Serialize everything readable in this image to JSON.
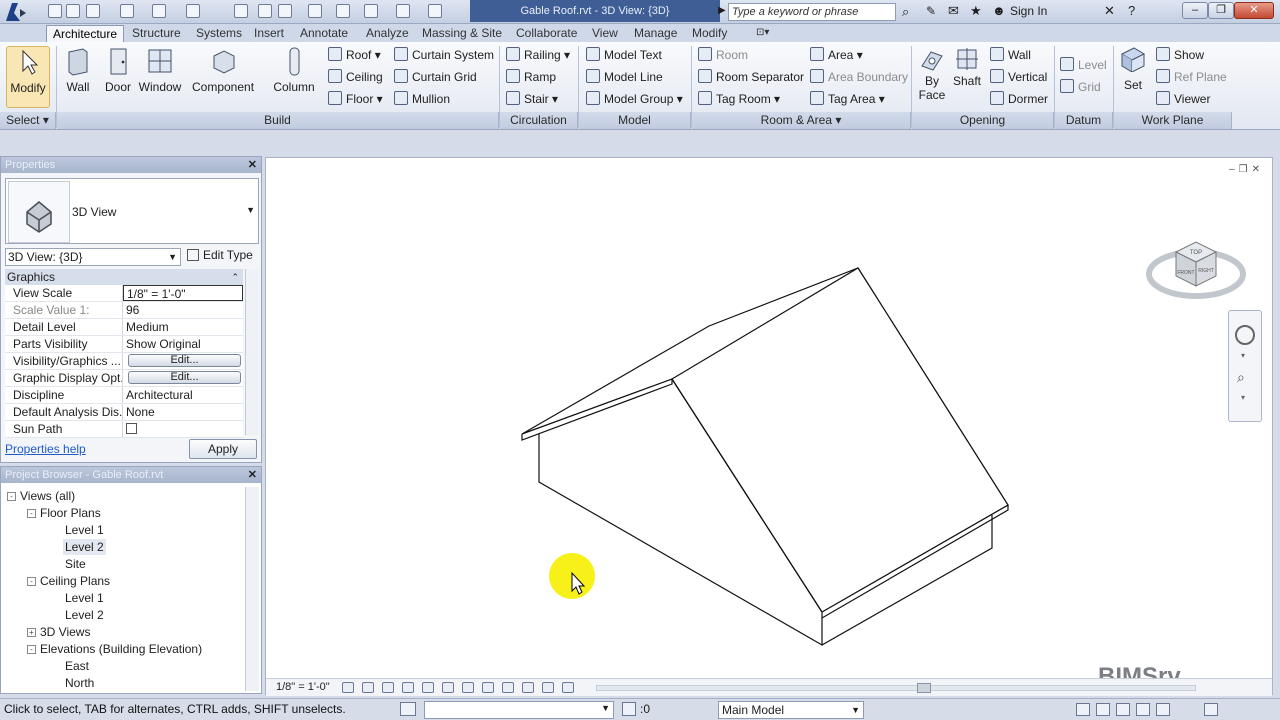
{
  "window": {
    "title": "Gable Roof.rvt - 3D View: {3D}",
    "search_placeholder": "Type a keyword or phrase",
    "sign_in": "Sign In"
  },
  "tabs": [
    "Architecture",
    "Structure",
    "Systems",
    "Insert",
    "Annotate",
    "Analyze",
    "Massing & Site",
    "Collaborate",
    "View",
    "Manage",
    "Modify"
  ],
  "ribbon": {
    "select": {
      "modify": "Modify",
      "panel": "Select"
    },
    "build": {
      "panel": "Build",
      "big": [
        "Wall",
        "Door",
        "Window",
        "Component",
        "Column"
      ],
      "roof": "Roof",
      "ceiling": "Ceiling",
      "floor": "Floor",
      "curtain_system": "Curtain System",
      "curtain_grid": "Curtain Grid",
      "mullion": "Mullion"
    },
    "circulation": {
      "panel": "Circulation",
      "railing": "Railing",
      "ramp": "Ramp",
      "stair": "Stair"
    },
    "model": {
      "panel": "Model",
      "model_text": "Model Text",
      "model_line": "Model Line",
      "model_group": "Model Group"
    },
    "room_area": {
      "panel": "Room & Area",
      "room": "Room",
      "room_separator": "Room Separator",
      "tag_room": "Tag Room",
      "area": "Area",
      "area_boundary": "Area Boundary",
      "tag_area": "Tag Area"
    },
    "opening": {
      "panel": "Opening",
      "by_face_1": "By",
      "by_face_2": "Face",
      "shaft": "Shaft",
      "wall": "Wall",
      "vertical": "Vertical",
      "dormer": "Dormer"
    },
    "datum": {
      "panel": "Datum",
      "level": "Level",
      "grid": "Grid"
    },
    "work_plane": {
      "panel": "Work Plane",
      "set": "Set",
      "show": "Show",
      "ref_plane": "Ref Plane",
      "viewer": "Viewer"
    }
  },
  "properties": {
    "title": "Properties",
    "type_name": "3D View",
    "view_select": "3D View: {3D}",
    "edit_type": "Edit Type",
    "section": "Graphics",
    "rows": [
      {
        "key": "View Scale",
        "value": "1/8\" = 1'-0\""
      },
      {
        "key": "Scale Value    1:",
        "value": "96"
      },
      {
        "key": "Detail Level",
        "value": "Medium"
      },
      {
        "key": "Parts Visibility",
        "value": "Show Original"
      },
      {
        "key": "Visibility/Graphics ...",
        "value": "Edit..."
      },
      {
        "key": "Graphic Display Opt...",
        "value": "Edit..."
      },
      {
        "key": "Discipline",
        "value": "Architectural"
      },
      {
        "key": "Default Analysis Dis...",
        "value": "None"
      },
      {
        "key": "Sun Path",
        "value": ""
      }
    ],
    "help": "Properties help",
    "apply": "Apply"
  },
  "browser": {
    "title": "Project Browser - Gable Roof.rvt",
    "items": [
      {
        "label": "Views (all)",
        "toggle": "-"
      },
      {
        "label": "Floor Plans",
        "toggle": "-"
      },
      {
        "label": "Level 1",
        "toggle": ""
      },
      {
        "label": "Level 2",
        "toggle": ""
      },
      {
        "label": "Site",
        "toggle": ""
      },
      {
        "label": "Ceiling Plans",
        "toggle": "-"
      },
      {
        "label": "Level 1",
        "toggle": ""
      },
      {
        "label": "Level 2",
        "toggle": ""
      },
      {
        "label": "3D Views",
        "toggle": "+"
      },
      {
        "label": "Elevations (Building Elevation)",
        "toggle": "-"
      },
      {
        "label": "East",
        "toggle": ""
      },
      {
        "label": "North",
        "toggle": ""
      }
    ]
  },
  "viewport": {
    "scale": "1/8\" = 1'-0\"",
    "viewcube_top": "TOP",
    "viewcube_front": "FRONT",
    "viewcube_right": "RIGHT",
    "watermark": "BIMSrv"
  },
  "status": {
    "text": "Click to select, TAB for alternates, CTRL adds, SHIFT unselects.",
    "counter": ":0",
    "model": "Main Model"
  },
  "colors": {
    "title_bar_active": "#3f5e96",
    "ribbon_bg": "#f9fafc",
    "cursor_highlight": "#f6f000"
  }
}
